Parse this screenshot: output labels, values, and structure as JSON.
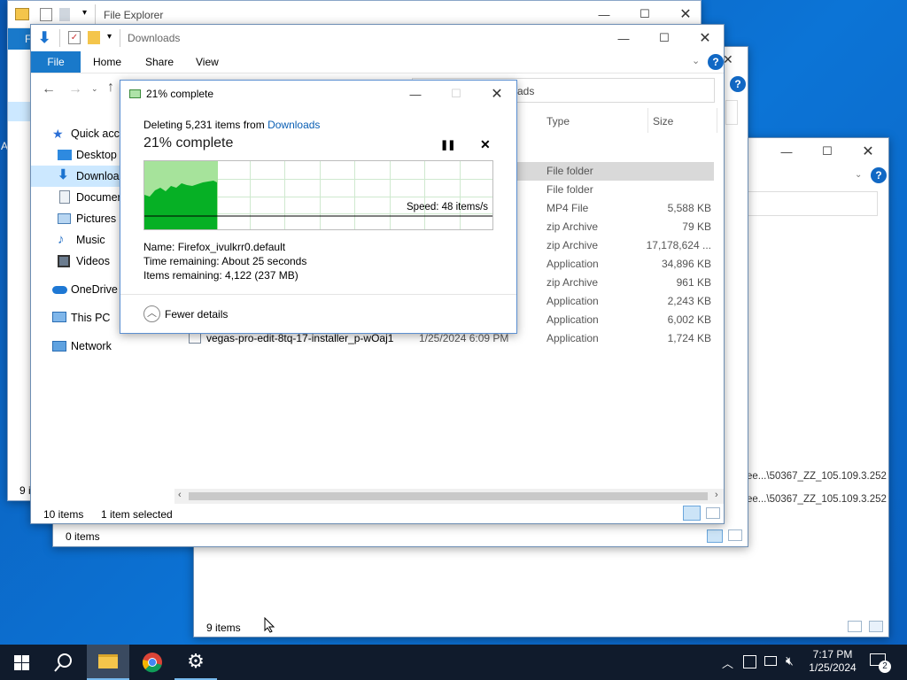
{
  "back_explorer": {
    "title": "File Explorer",
    "ribbon_letter": "F",
    "items_count": "9 i"
  },
  "right_window": {
    "status": "9 items",
    "rows": [
      "ee...\\50367_ZZ_105.109.3.252",
      "ee...\\50367_ZZ_105.109.3.252"
    ]
  },
  "mid_window": {
    "status": "0 items"
  },
  "downloads": {
    "title": "Downloads",
    "ribbon_tabs": [
      "File",
      "Home",
      "Share",
      "View"
    ],
    "address_fragment": "ads",
    "columns": {
      "type": "Type",
      "size": "Size"
    },
    "rows": [
      {
        "type": "File folder",
        "size": ""
      },
      {
        "type": "File folder",
        "size": ""
      },
      {
        "type": "MP4 File",
        "size": "5,588 KB"
      },
      {
        "type": "zip Archive",
        "size": "79 KB"
      },
      {
        "type": "zip Archive",
        "size": "17,178,624 ..."
      },
      {
        "type": "Application",
        "size": "34,896 KB"
      },
      {
        "type": "zip Archive",
        "size": "961 KB"
      },
      {
        "type": "Application",
        "size": "2,243 KB"
      },
      {
        "type": "Application",
        "size": "6,002 KB"
      },
      {
        "name": "vegas-pro-edit-8tq-17-installer_p-wOaj1",
        "date": "1/25/2024 6:09 PM",
        "type": "Application",
        "size": "1,724 KB"
      }
    ],
    "nav": {
      "quick_access": "Quick acce",
      "desktop": "Desktop",
      "downloads": "Downloa",
      "documents": "Documer",
      "pictures": "Pictures",
      "music": "Music",
      "videos": "Videos",
      "onedrive": "OneDrive",
      "this_pc": "This PC",
      "network": "Network"
    },
    "status_items": "10 items",
    "status_selected": "1 item selected"
  },
  "progress_dialog": {
    "title": "21% complete",
    "deleting_prefix": "Deleting 5,231 items from ",
    "deleting_link": "Downloads",
    "heading": "21% complete",
    "speed": "Speed: 48 items/s",
    "progress": 0.21,
    "name_label": "Name:",
    "name_value": "Firefox_ivulkrr0.default",
    "time_label": "Time remaining:",
    "time_value": "About 25 seconds",
    "items_label": "Items remaining:",
    "items_value": "4,122 (237 MB)",
    "fewer_details": "Fewer details"
  },
  "taskbar": {
    "time": "7:17 PM",
    "date": "1/25/2024",
    "notifications": "2"
  },
  "colors": {
    "accent": "#0078d7",
    "progress_fill": "#06b025",
    "taskbar": "#101b2c"
  }
}
